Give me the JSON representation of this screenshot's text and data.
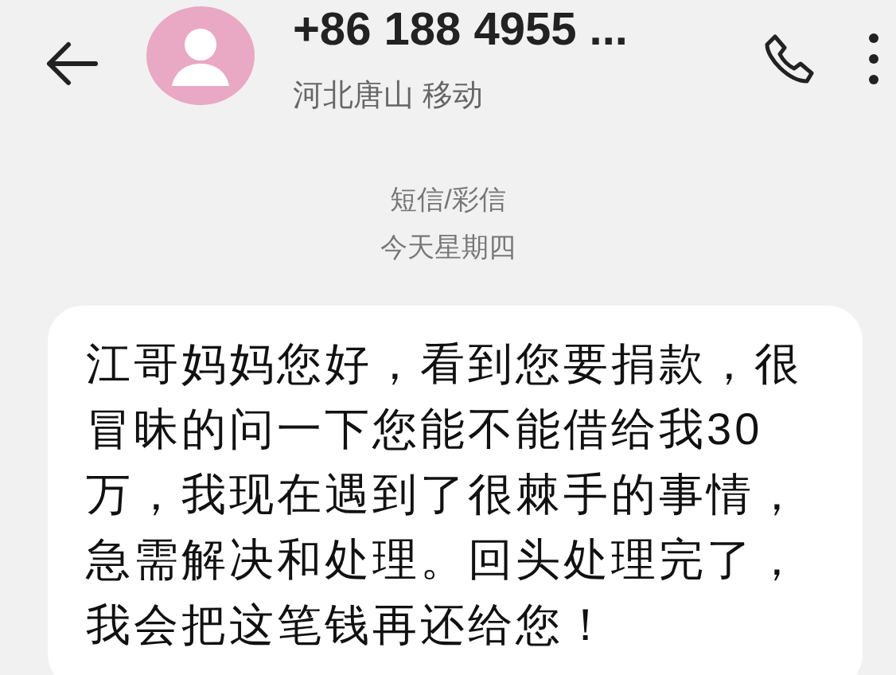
{
  "header": {
    "title": "+86 188 4955 ...",
    "subtitle": "河北唐山 移动"
  },
  "thread": {
    "channel": "短信/彩信",
    "date": "今天星期四"
  },
  "messages": [
    {
      "text": "江哥妈妈您好，看到您要捐款，很冒昧的问一下您能不能借给我30万，我现在遇到了很棘手的事情，急需解决和处理。回头处理完了，我会把这笔钱再还给您！"
    }
  ]
}
